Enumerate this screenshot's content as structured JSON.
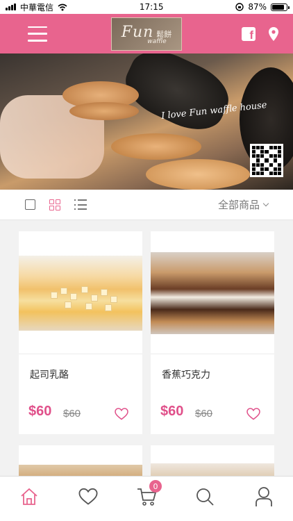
{
  "status_bar": {
    "carrier": "中華電信",
    "time": "17:15",
    "battery": "87%",
    "battery_level": 0.87
  },
  "header": {
    "logo_main": "Fun",
    "logo_cjk": "鬆餅",
    "logo_sub": "waffle"
  },
  "hero": {
    "script_text": "I love Fun waffle house"
  },
  "toolbar": {
    "filter_label": "全部商品"
  },
  "products": [
    {
      "name": "起司乳酪",
      "price": "$60",
      "original_price": "$60"
    },
    {
      "name": "香蕉巧克力",
      "price": "$60",
      "original_price": "$60"
    }
  ],
  "cart": {
    "count": "0"
  },
  "colors": {
    "brand": "#e8648e",
    "price": "#e0508a"
  },
  "icons": [
    "hamburger-icon",
    "facebook-icon",
    "location-pin-icon",
    "grid-view-icon",
    "list-view-icon",
    "heart-icon",
    "home-icon",
    "cart-icon",
    "search-icon",
    "user-icon"
  ]
}
